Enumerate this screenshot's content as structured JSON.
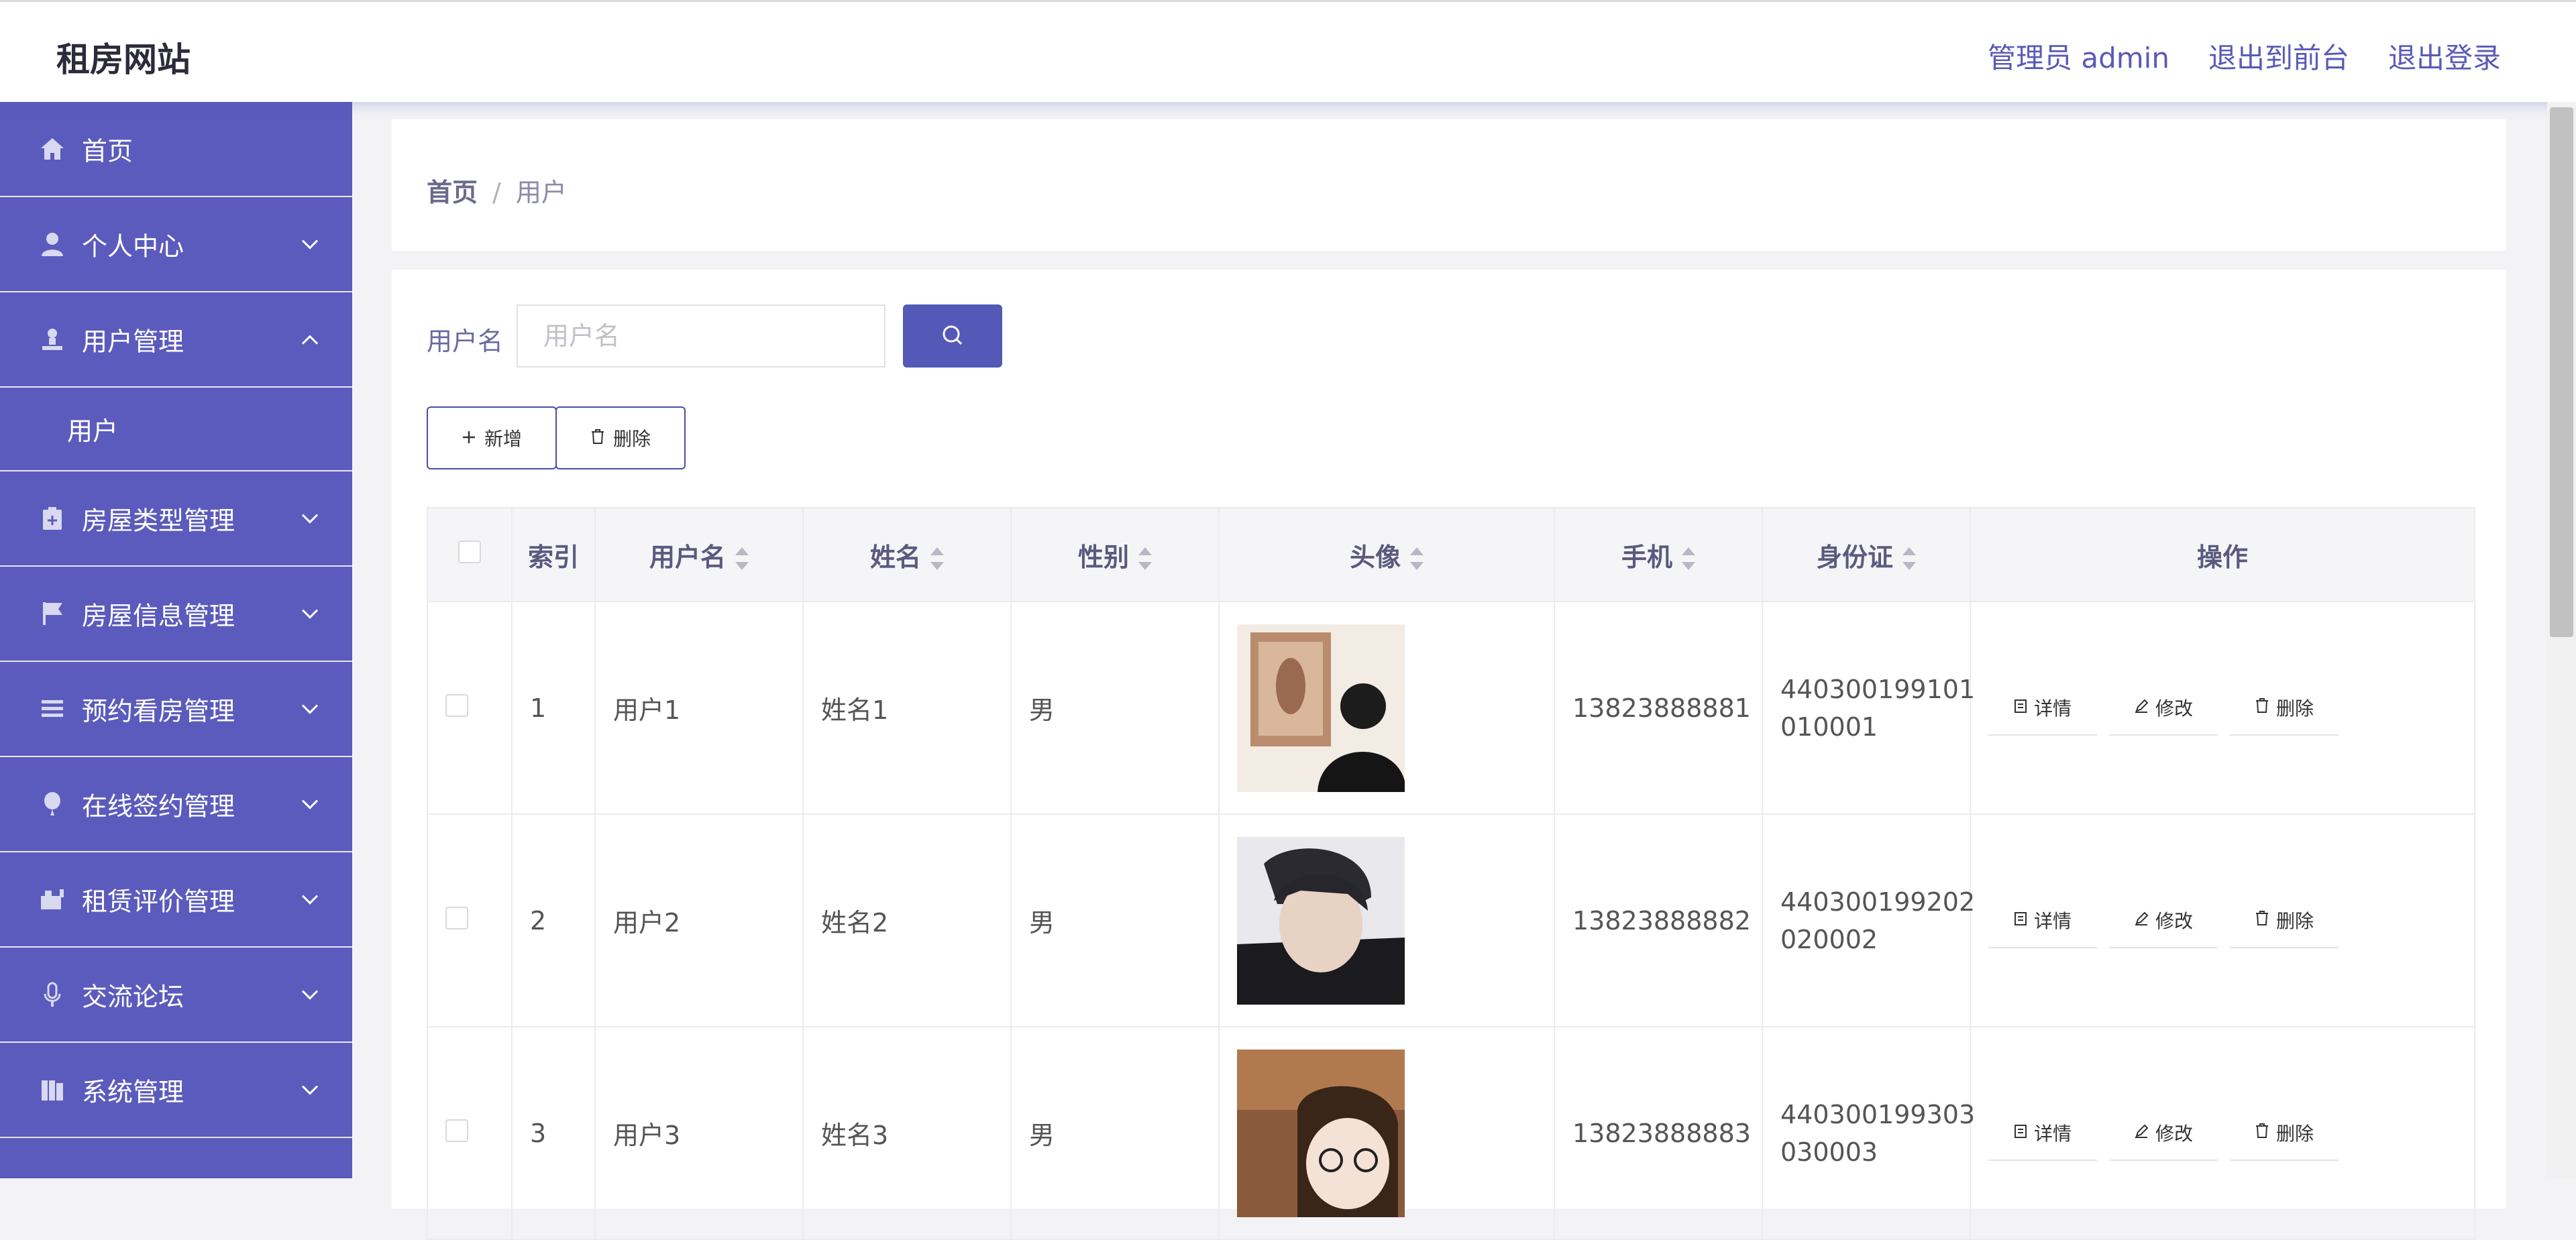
{
  "header": {
    "brand": "租房网站",
    "admin": "管理员 admin",
    "to_front": "退出到前台",
    "logout": "退出登录"
  },
  "sidebar": {
    "items": [
      {
        "label": "首页",
        "icon": "home-icon"
      },
      {
        "label": "个人中心",
        "icon": "user-icon"
      },
      {
        "label": "用户管理",
        "icon": "user-manage-icon"
      },
      {
        "label": "房屋类型管理",
        "icon": "house-type-icon"
      },
      {
        "label": "房屋信息管理",
        "icon": "flag-icon"
      },
      {
        "label": "预约看房管理",
        "icon": "list-icon"
      },
      {
        "label": "在线签约管理",
        "icon": "balloon-icon"
      },
      {
        "label": "租赁评价管理",
        "icon": "comment-icon"
      },
      {
        "label": "交流论坛",
        "icon": "microphone-icon"
      },
      {
        "label": "系统管理",
        "icon": "system-icon"
      }
    ],
    "sub_item": "用户"
  },
  "breadcrumb": {
    "home": "首页",
    "sep": "/",
    "current": "用户"
  },
  "search": {
    "label": "用户名",
    "placeholder": "用户名",
    "value": ""
  },
  "actions": {
    "add": "新增",
    "delete": "删除"
  },
  "table": {
    "headers": [
      "索引",
      "用户名",
      "姓名",
      "性别",
      "头像",
      "手机",
      "身份证",
      "操作"
    ],
    "rows": [
      {
        "index": "1",
        "username": "用户1",
        "name": "姓名1",
        "gender": "男",
        "avatar": "avatar-photo-1",
        "phone": "13823888881",
        "id_line1": "440300199101",
        "id_line2": "010001"
      },
      {
        "index": "2",
        "username": "用户2",
        "name": "姓名2",
        "gender": "男",
        "avatar": "avatar-photo-2",
        "phone": "13823888882",
        "id_line1": "440300199202",
        "id_line2": "020002"
      },
      {
        "index": "3",
        "username": "用户3",
        "name": "姓名3",
        "gender": "男",
        "avatar": "avatar-photo-3",
        "phone": "13823888883",
        "id_line1": "440300199303",
        "id_line2": "030003"
      }
    ],
    "ops": {
      "detail": "详情",
      "edit": "修改",
      "delete": "删除"
    }
  },
  "colors": {
    "accent": "#5b5bbd",
    "header_link": "#5a5ab8",
    "button": "#5458b6"
  }
}
